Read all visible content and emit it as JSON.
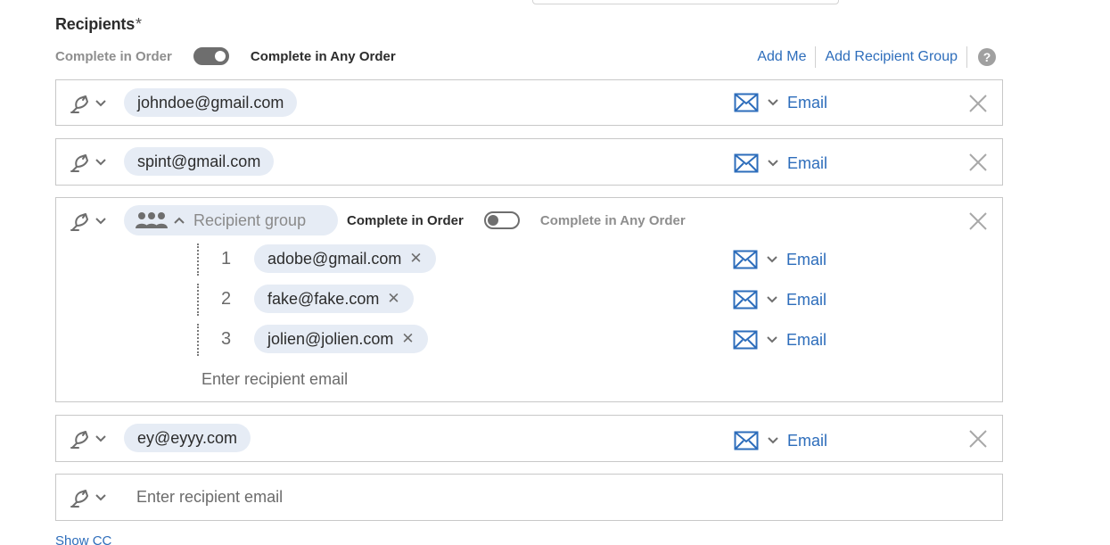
{
  "header": {
    "title": "Recipients",
    "required_mark": "*",
    "order_left": "Complete in Order",
    "order_right": "Complete in Any Order"
  },
  "links": {
    "add_me": "Add Me",
    "add_group": "Add Recipient Group",
    "help": "?"
  },
  "rows": [
    {
      "email": "johndoe@gmail.com",
      "delivery": "Email"
    },
    {
      "email": "spint@gmail.com",
      "delivery": "Email"
    }
  ],
  "group": {
    "name_placeholder": "Recipient group",
    "order_left": "Complete in Order",
    "order_right": "Complete in Any Order",
    "members": [
      {
        "number": "1",
        "email": "adobe@gmail.com",
        "delivery": "Email"
      },
      {
        "number": "2",
        "email": "fake@fake.com",
        "delivery": "Email"
      },
      {
        "number": "3",
        "email": "jolien@jolien.com",
        "delivery": "Email"
      }
    ],
    "enter_placeholder": "Enter recipient email"
  },
  "row_after_group": {
    "email": "ey@eyyy.com",
    "delivery": "Email"
  },
  "empty_row": {
    "placeholder": "Enter recipient email"
  },
  "footer": {
    "show_cc": "Show CC"
  },
  "colors": {
    "link": "#2d6dbb",
    "chip_bg": "#e6ecf5",
    "border": "#c8c8c8"
  },
  "icons": {
    "pen": "pen-signature-icon",
    "mail": "envelope-icon",
    "close": "close-x-icon",
    "group": "people-group-icon",
    "chevron": "chevron-down-icon"
  }
}
